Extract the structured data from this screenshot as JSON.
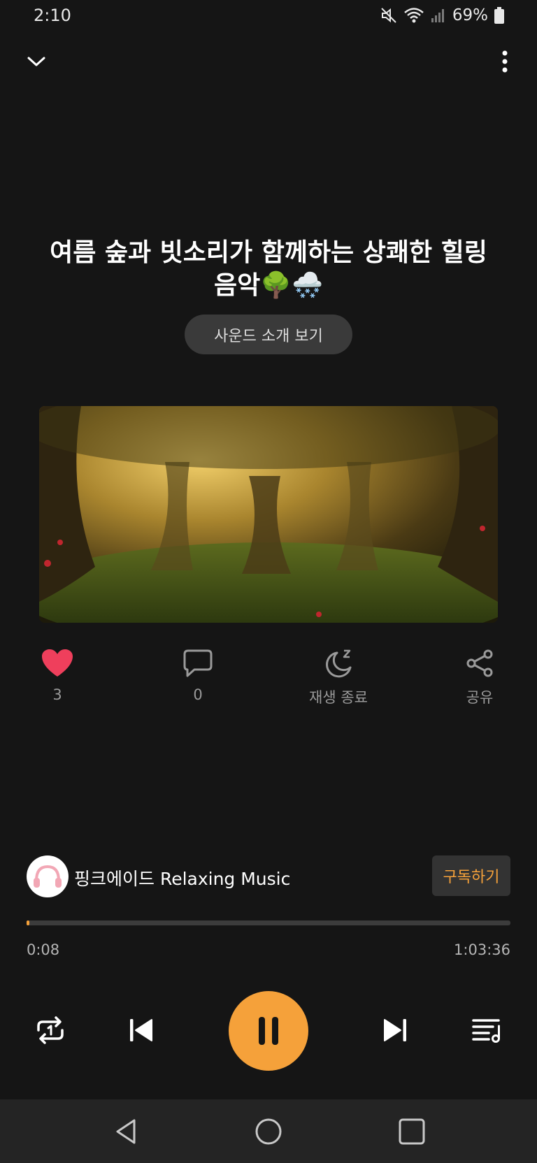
{
  "status_bar": {
    "time": "2:10",
    "battery": "69%"
  },
  "track": {
    "title": "여름 숲과 빗소리가 함께하는 상쾌한 힐링 음악🌳🌨️",
    "intro_button": "사운드 소개 보기",
    "artwork": "forest-artwork"
  },
  "actions": {
    "like_count": "3",
    "comment_count": "0",
    "sleep_label": "재생 종료",
    "share_label": "공유"
  },
  "channel": {
    "name": "핑크에이드 Relaxing Music",
    "subscribe_label": "구독하기"
  },
  "player": {
    "current_time": "0:08",
    "total_time": "1:03:36",
    "progress_fraction": 0.0021,
    "state": "playing"
  },
  "colors": {
    "accent": "#f5a13a",
    "like": "#ef3f5c",
    "background": "#151515"
  },
  "icons": {
    "collapse": "chevron-down-icon",
    "more": "more-vertical-icon",
    "like": "heart-icon",
    "comment": "comment-icon",
    "sleep": "moon-sleep-icon",
    "share": "share-icon",
    "repeat": "repeat-one-icon",
    "prev": "skip-previous-icon",
    "pause": "pause-icon",
    "next": "skip-next-icon",
    "queue": "playlist-icon"
  }
}
